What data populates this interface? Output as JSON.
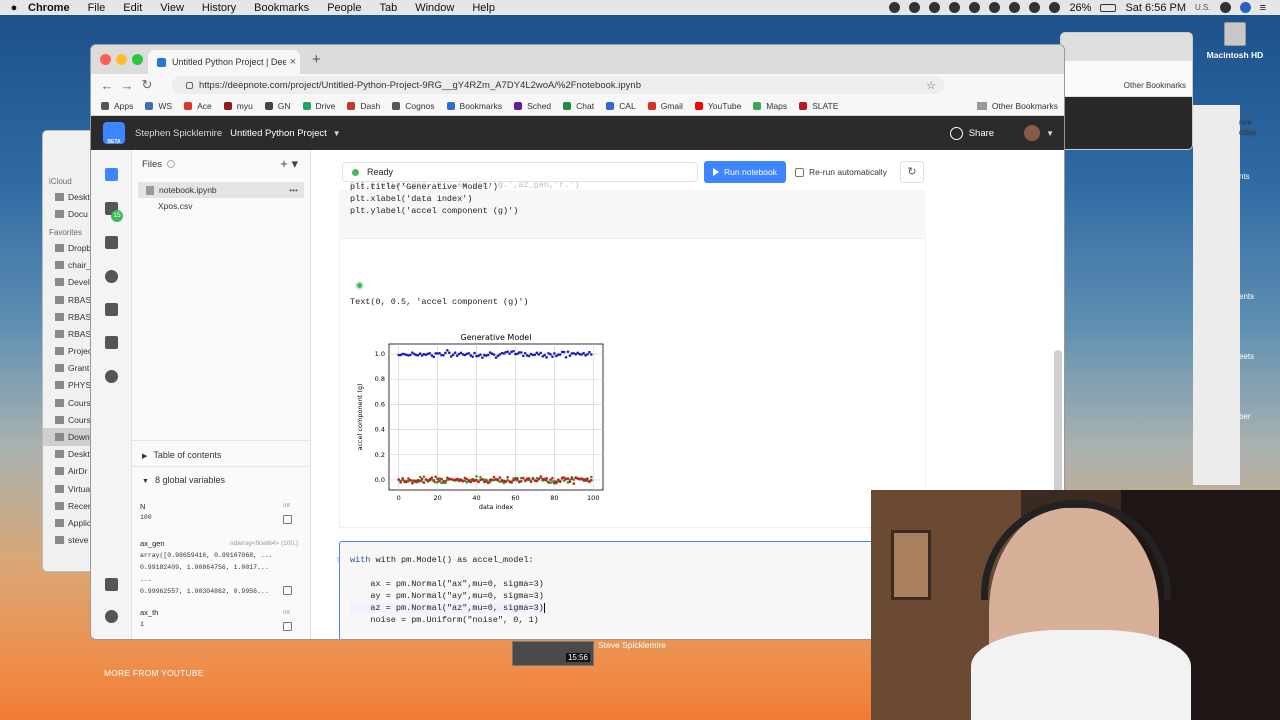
{
  "menubar": {
    "app": "Chrome",
    "items": [
      "File",
      "Edit",
      "View",
      "History",
      "Bookmarks",
      "People",
      "Tab",
      "Window",
      "Help"
    ],
    "battery": "26%",
    "clock": "Sat 6:56 PM",
    "locale": "U.S."
  },
  "desktop": {
    "drive_label": "Macintosh HD",
    "right_fragments": [
      "rive",
      "nts",
      "ents",
      "eets",
      "ber",
      "oday",
      "Other Bookmarks"
    ]
  },
  "finder": {
    "section_icloud": "iCloud",
    "section_favorites": "Favorites",
    "rows": [
      "Deskt",
      "Docu",
      "Dropb",
      "chair_",
      "Devel",
      "RBAS",
      "RBAS",
      "RBAS",
      "Projec",
      "Grant",
      "PHYS",
      "Cours",
      "Cours",
      "Down",
      "Deskt",
      "AirDr",
      "Virtua",
      "Recen",
      "Applic",
      "steve"
    ]
  },
  "browser": {
    "tab_title": "Untitled Python Project | Deep",
    "url": "https://deepnote.com/project/Untitled-Python-Project-9RG__gY4RZm_A7DY4L2woA/%2Fnotebook.ipynb",
    "bookmarks": [
      {
        "label": "Apps",
        "color": "#555555"
      },
      {
        "label": "WS",
        "color": "#3d6fb8"
      },
      {
        "label": "Ace",
        "color": "#d33a2c"
      },
      {
        "label": "myu",
        "color": "#8a1c1c"
      },
      {
        "label": "GN",
        "color": "#444444"
      },
      {
        "label": "Drive",
        "color": "#1fa463"
      },
      {
        "label": "Dash",
        "color": "#c0392b"
      },
      {
        "label": "Cognos",
        "color": "#555555"
      },
      {
        "label": "Bookmarks",
        "color": "#2e6bd1"
      },
      {
        "label": "Sched",
        "color": "#6a1b9a"
      },
      {
        "label": "Chat",
        "color": "#1e8e3e"
      },
      {
        "label": "CAL",
        "color": "#2e6bd1"
      },
      {
        "label": "Gmail",
        "color": "#d93025"
      },
      {
        "label": "YouTube",
        "color": "#ff0000"
      },
      {
        "label": "Maps",
        "color": "#34a853"
      },
      {
        "label": "SLATE",
        "color": "#b71c1c"
      }
    ],
    "other_bookmarks": "Other Bookmarks"
  },
  "deepnote": {
    "beta": "BETA",
    "user": "Stephen Spicklemire",
    "project": "Untitled Python Project",
    "share": "Share",
    "rail_badge": "15",
    "files_title": "Files",
    "files": [
      "notebook.ipynb",
      "Xpos.csv"
    ],
    "toc": "Table of contents",
    "globals": "8 global variables",
    "vars": [
      {
        "name": "N",
        "type": "int",
        "value": "100"
      },
      {
        "name": "ax_gen",
        "type": "ndarray<float64> (100,)",
        "value": "array([0.98659416, 0.99107068, ...\n0.99182409, 1.00864756, 1.0017...\n...\n0.99962557, 1.00304862, 0.9956..."
      },
      {
        "name": "ax_th",
        "type": "int",
        "value": "1"
      }
    ],
    "status": "Ready",
    "run_button": "Run notebook",
    "rerun": "Re-run automatically",
    "cell1_code": [
      "plt.title('Generative Model')",
      "plt.xlabel('data index')",
      "plt.ylabel('accel component (g)')"
    ],
    "cell1_output": "Text(0, 0.5, 'accel component (g)')",
    "cell2_code": [
      "with pm.Model() as accel_model:",
      "",
      "    ax = pm.Normal(\"ax\",mu=0, sigma=3)",
      "    ay = pm.Normal(\"ay\",mu=0, sigma=3)",
      "    az = pm.Normal(\"az\",mu=0, sigma=3)",
      "    noise = pm.Uniform(\"noise\", 0, 1)",
      "",
      ""
    ]
  },
  "youtube": {
    "more": "MORE FROM YOUTUBE",
    "duration": "15:56",
    "channel": "Steve Spicklemire"
  },
  "chart_data": {
    "type": "scatter",
    "title": "Generative Model",
    "xlabel": "data index",
    "ylabel": "accel component (g)",
    "xlim": [
      -5,
      105
    ],
    "ylim": [
      -0.08,
      1.08
    ],
    "xticks": [
      0,
      20,
      40,
      60,
      80,
      100
    ],
    "yticks": [
      0.0,
      0.2,
      0.4,
      0.6,
      0.8,
      1.0
    ],
    "grid": true,
    "series": [
      {
        "color": "#1f1fbf",
        "center": 1.0,
        "noise": 0.012,
        "n": 100
      },
      {
        "color": "#2e9e2e",
        "center": 0.0,
        "noise": 0.012,
        "n": 100
      },
      {
        "color": "#c02020",
        "center": 0.0,
        "noise": 0.012,
        "n": 100
      }
    ]
  }
}
